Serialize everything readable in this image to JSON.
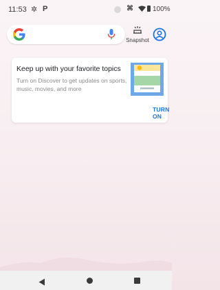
{
  "status_bar": {
    "time": "11:53",
    "battery": "100%",
    "icons": [
      "settings-icon",
      "p-key-icon",
      "notification-dot-icon",
      "vibrate-icon",
      "wifi-icon",
      "battery-icon"
    ]
  },
  "search": {
    "logo": "G",
    "mic_icon": "mic-icon"
  },
  "snapshot": {
    "label": "Snapshot",
    "icon": "snapshot-icon"
  },
  "account": {
    "icon": "account-circle-icon"
  },
  "discover_card": {
    "title": "Keep up with your favorite topics",
    "description": "Turn on Discover to get updates on sports, music, movies, and more",
    "action": "TURN ON"
  },
  "navigation_bar": {
    "items": [
      "back-icon",
      "home-icon",
      "recents-icon"
    ]
  },
  "colors": {
    "accent": "#1a73e8",
    "google_blue": "#4285f4",
    "google_red": "#ea4335",
    "google_yellow": "#fbbc05",
    "google_green": "#34a853",
    "background": "#f8eef1"
  }
}
